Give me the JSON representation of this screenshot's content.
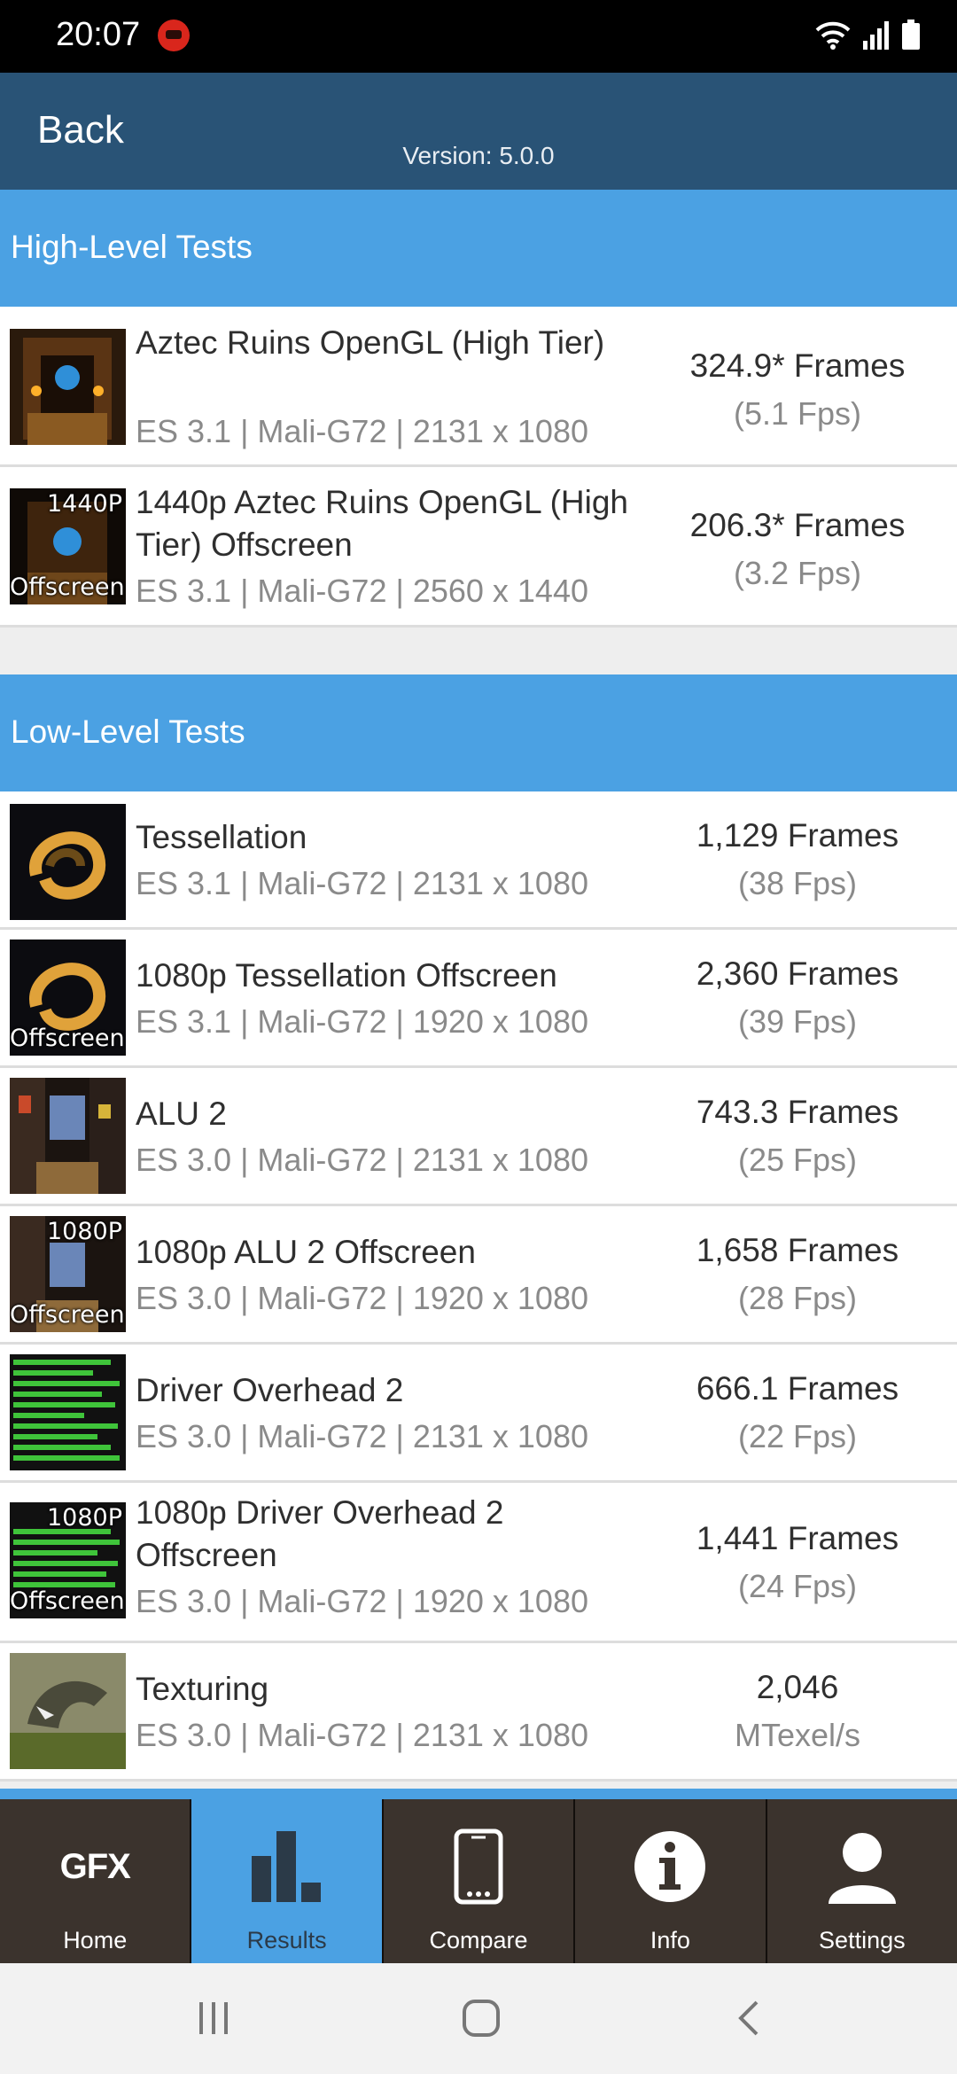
{
  "status_bar": {
    "time": "20:07"
  },
  "header": {
    "back_label": "Back",
    "version": "Version: 5.0.0"
  },
  "high_level": {
    "title": "High-Level Tests",
    "rows": [
      {
        "title": "Aztec Ruins OpenGL (High Tier)",
        "subtitle": "ES 3.1 | Mali-G72 | 2131 x 1080",
        "score": "324.9* Frames",
        "fps": "(5.1 Fps)",
        "tag_top": "",
        "tag_bottom": ""
      },
      {
        "title": "1440p Aztec Ruins OpenGL (High Tier) Offscreen",
        "subtitle": "ES 3.1 | Mali-G72 | 2560 x 1440",
        "score": "206.3* Frames",
        "fps": "(3.2 Fps)",
        "tag_top": "1440P",
        "tag_bottom": "Offscreen"
      }
    ]
  },
  "low_level": {
    "title": "Low-Level Tests",
    "rows": [
      {
        "title": "Tessellation",
        "subtitle": "ES 3.1 | Mali-G72 | 2131 x 1080",
        "score": "1,129 Frames",
        "fps": "(38 Fps)",
        "tag_top": "",
        "tag_bottom": ""
      },
      {
        "title": "1080p Tessellation Offscreen",
        "subtitle": "ES 3.1 | Mali-G72 | 1920 x 1080",
        "score": "2,360 Frames",
        "fps": "(39 Fps)",
        "tag_top": "",
        "tag_bottom": "Offscreen"
      },
      {
        "title": "ALU 2",
        "subtitle": "ES 3.0 | Mali-G72 | 2131 x 1080",
        "score": "743.3 Frames",
        "fps": "(25 Fps)",
        "tag_top": "",
        "tag_bottom": ""
      },
      {
        "title": "1080p ALU 2 Offscreen",
        "subtitle": "ES 3.0 | Mali-G72 | 1920 x 1080",
        "score": "1,658 Frames",
        "fps": "(28 Fps)",
        "tag_top": "1080P",
        "tag_bottom": "Offscreen"
      },
      {
        "title": "Driver Overhead 2",
        "subtitle": "ES 3.0 | Mali-G72 | 2131 x 1080",
        "score": "666.1 Frames",
        "fps": "(22 Fps)",
        "tag_top": "",
        "tag_bottom": ""
      },
      {
        "title": "1080p Driver Overhead 2 Offscreen",
        "subtitle": "ES 3.0 | Mali-G72 | 1920 x 1080",
        "score": "1,441 Frames",
        "fps": "(24 Fps)",
        "tag_top": "1080P",
        "tag_bottom": "Offscreen"
      },
      {
        "title": "Texturing",
        "subtitle": "ES 3.0 | Mali-G72 | 2131 x 1080",
        "score": "2,046",
        "fps": "MTexel/s",
        "tag_top": "",
        "tag_bottom": ""
      }
    ]
  },
  "bottom_nav": {
    "logo_text": "GFX",
    "items": [
      {
        "label": "Home",
        "icon": "gfx-logo-icon"
      },
      {
        "label": "Results",
        "icon": "bar-chart-icon"
      },
      {
        "label": "Compare",
        "icon": "phone-icon"
      },
      {
        "label": "Info",
        "icon": "info-icon"
      },
      {
        "label": "Settings",
        "icon": "user-icon"
      }
    ]
  },
  "colors": {
    "header": "#295376",
    "accent": "#4ba1e3",
    "nav_bg": "#3b332d"
  }
}
